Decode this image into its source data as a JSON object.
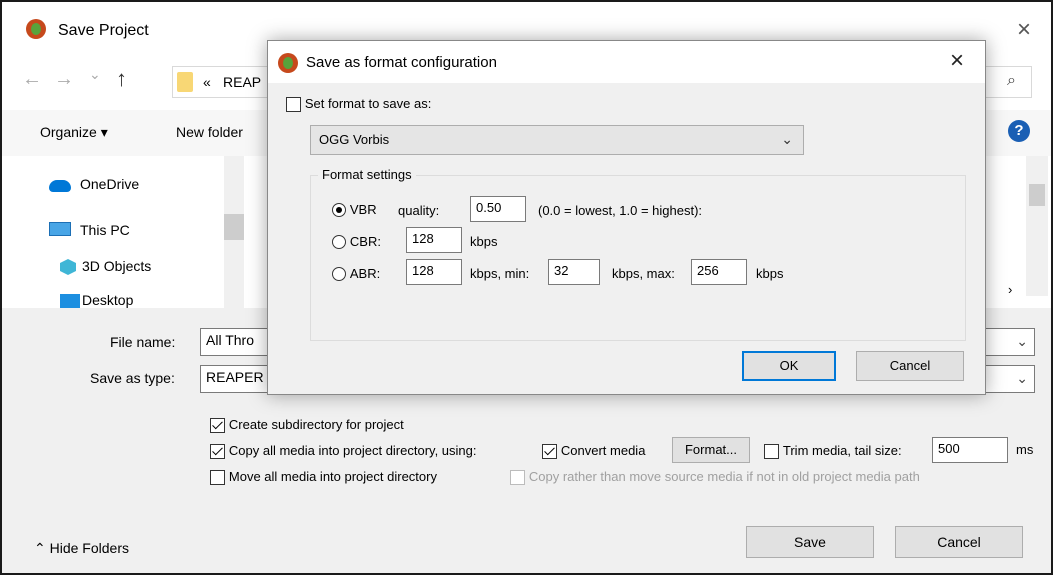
{
  "outer": {
    "title": "Save Project",
    "close_glyph": "×",
    "nav": {
      "back": "←",
      "forward": "→",
      "down": "⌄",
      "up": "↑",
      "path_prefix": "«",
      "path": "REAP",
      "search_icon": "⌕"
    },
    "toolbar": {
      "organize": "Organize ▾",
      "new_folder": "New folder",
      "help": "?"
    },
    "sidebar": [
      {
        "label": "OneDrive",
        "icon": "cloud-icon"
      },
      {
        "label": "This PC",
        "icon": "computer-icon"
      },
      {
        "label": "3D Objects",
        "icon": "cube-icon"
      },
      {
        "label": "Desktop",
        "icon": "desktop-icon"
      }
    ],
    "file_name_label": "File name:",
    "file_name_value": "All Thro",
    "save_type_label": "Save as type:",
    "save_type_value": "REAPER",
    "options": {
      "create_subdir": "Create subdirectory for project",
      "copy_media": "Copy all media into project directory, using:",
      "convert_media": "Convert media",
      "format_button": "Format...",
      "trim_media": "Trim media, tail size:",
      "trim_value": "500",
      "trim_unit": "ms",
      "move_media": "Move all media into project directory",
      "copy_rather": "Copy rather than move source media if not in old project media path"
    },
    "hide_folders": "Hide Folders",
    "save_button": "Save",
    "cancel_button": "Cancel"
  },
  "modal": {
    "title": "Save as format configuration",
    "close_glyph": "×",
    "set_format_label": "Set format to save as:",
    "format_value": "OGG Vorbis",
    "group_label": "Format settings",
    "vbr": {
      "label": "VBR",
      "quality_label": "quality:",
      "quality_value": "0.50",
      "hint": "(0.0 = lowest, 1.0 = highest):"
    },
    "cbr": {
      "label": "CBR:",
      "value": "128",
      "unit": "kbps"
    },
    "abr": {
      "label": "ABR:",
      "value": "128",
      "min_label": "kbps, min:",
      "min_value": "32",
      "max_label": "kbps, max:",
      "max_value": "256",
      "unit": "kbps"
    },
    "ok": "OK",
    "cancel": "Cancel"
  },
  "colors": {
    "accent": "#0078d7",
    "help": "#1a5fb4",
    "reaper_red": "#c6491c",
    "reaper_green": "#58a33b"
  }
}
